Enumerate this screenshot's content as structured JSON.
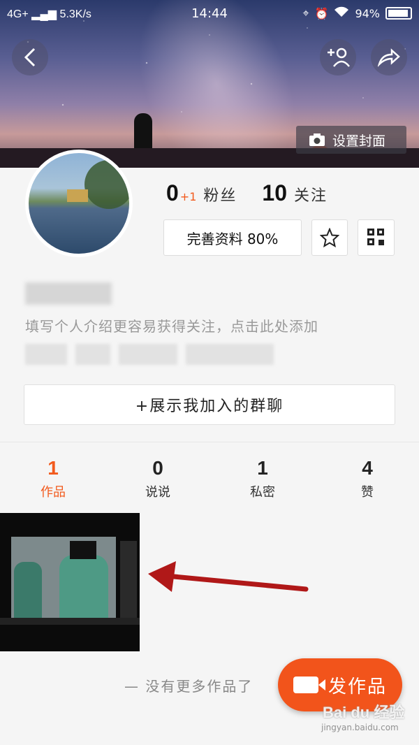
{
  "status_bar": {
    "network": "4G+",
    "speed": "5.3K/s",
    "time": "14:44",
    "battery": "94%"
  },
  "header": {
    "set_cover_label": "设置封面"
  },
  "profile": {
    "fans_count": "0",
    "fans_delta": "+1",
    "fans_label": "粉丝",
    "following_count": "10",
    "following_label": "关注",
    "complete_profile_label": "完善资料 80%",
    "intro_placeholder": "填写个人介绍更容易获得关注，点击此处添加",
    "show_groups_label": "+展示我加入的群聊"
  },
  "tabs": [
    {
      "count": "1",
      "label": "作品",
      "active": true
    },
    {
      "count": "0",
      "label": "说说",
      "active": false
    },
    {
      "count": "1",
      "label": "私密",
      "active": false
    },
    {
      "count": "4",
      "label": "赞",
      "active": false
    }
  ],
  "footer": {
    "no_more_text": "— 没有更多作品了",
    "publish_label": "发作品"
  },
  "watermark": {
    "brand": "Bai du 经验",
    "url": "jingyan.baidu.com"
  },
  "colors": {
    "accent": "#f2541b",
    "background": "#f5f5f5",
    "arrow": "#b01818"
  },
  "icons": {
    "back": "chevron-left-icon",
    "add_follow": "add-user-icon",
    "share": "share-arrow-icon",
    "camera": "camera-icon",
    "star": "star-icon",
    "qr": "qr-code-icon",
    "publish": "video-camera-icon"
  }
}
